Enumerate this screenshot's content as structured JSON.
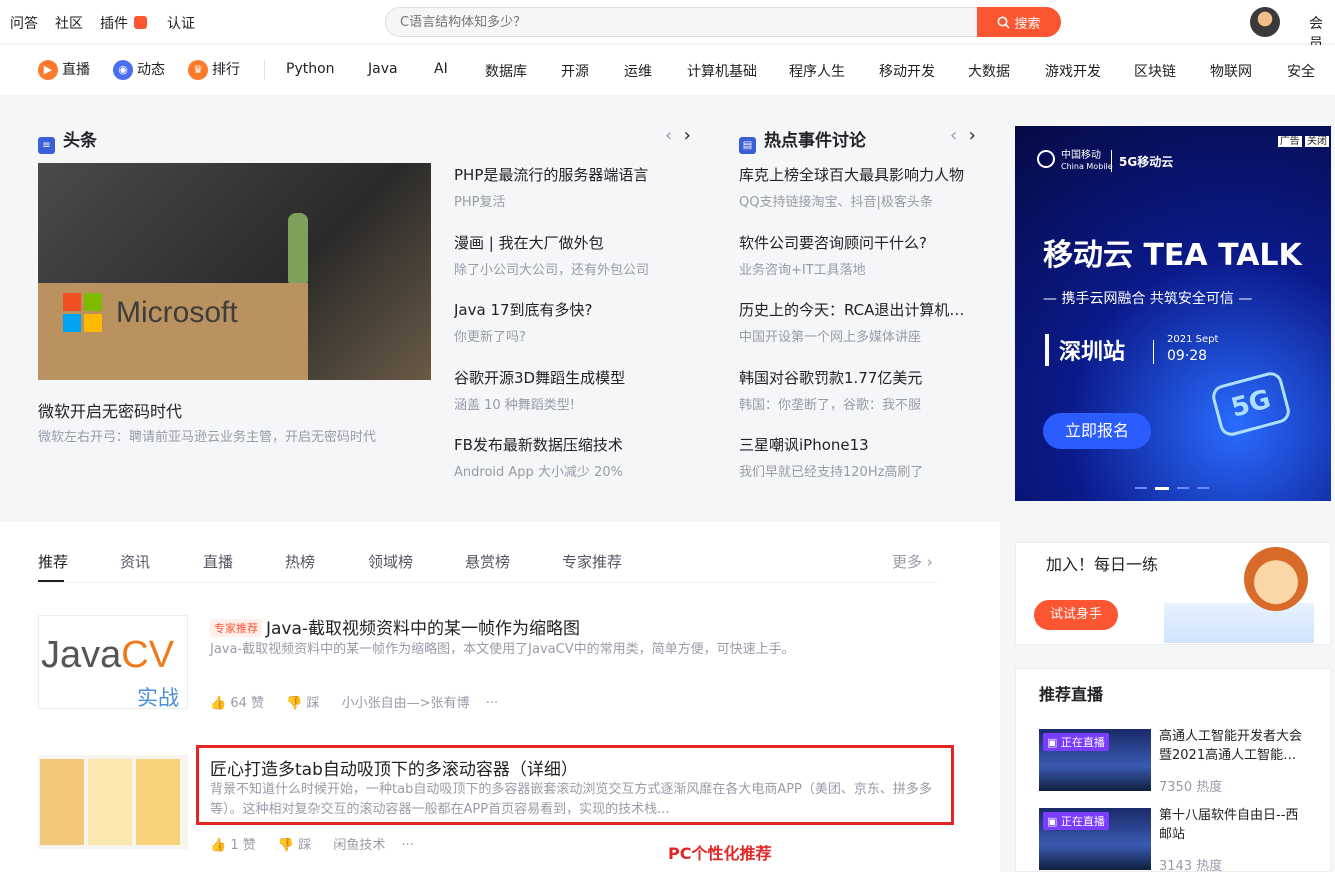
{
  "top": {
    "links": [
      "问答",
      "社区",
      "插件",
      "认证"
    ],
    "search_placeholder": "C语言结构体知多少？",
    "search_button": "搜索",
    "vip": "会员"
  },
  "nav": {
    "icon_items": [
      "直播",
      "动态",
      "排行"
    ],
    "items": [
      "Python",
      "Java",
      "AI",
      "数据库",
      "开源",
      "运维",
      "计算机基础",
      "程序人生",
      "移动开发",
      "大数据",
      "游戏开发",
      "区块链",
      "物联网",
      "安全"
    ]
  },
  "headline": {
    "title": "头条",
    "hero_text": "Microsoft",
    "hero_title": "微软开启无密码时代",
    "hero_sub": "微软左右开弓：聘请前亚马逊云业务主管，开启无密码时代",
    "news": [
      {
        "title": "PHP是最流行的服务器端语言",
        "sub": "PHP复活"
      },
      {
        "title": "漫画 | 我在大厂做外包",
        "sub": "除了小公司大公司，还有外包公司"
      },
      {
        "title": "Java 17到底有多快?",
        "sub": "你更新了吗?"
      },
      {
        "title": "谷歌开源3D舞蹈生成模型",
        "sub": "涵盖 10 种舞蹈类型!"
      },
      {
        "title": "FB发布最新数据压缩技术",
        "sub": "Android App 大小减少 20%"
      }
    ]
  },
  "hot": {
    "title": "热点事件讨论",
    "news": [
      {
        "title": "库克上榜全球百大最具影响力人物",
        "sub": "QQ支持链接淘宝、抖音|极客头条"
      },
      {
        "title": "软件公司要咨询顾问干什么?",
        "sub": "业务咨询+IT工具落地"
      },
      {
        "title": "历史上的今天：RCA退出计算机…",
        "sub": "中国开设第一个网上多媒体讲座"
      },
      {
        "title": "韩国对谷歌罚款1.77亿美元",
        "sub": "韩国：你垄断了，谷歌：我不服"
      },
      {
        "title": "三星嘲讽iPhone13",
        "sub": "我们早就已经支持120Hz高刷了"
      }
    ]
  },
  "ad": {
    "tags": [
      "广告",
      "关闭"
    ],
    "brand": "中国移动",
    "brand_en": "China Mobile",
    "brand2": "5G移动云",
    "headline": "移动云 TEA TALK",
    "tagline": "— 携手云网融合 共筑安全可信 —",
    "city": "深圳站",
    "date_line1": "2021 Sept",
    "date_line2": "09·28",
    "badge": "5G",
    "cta": "立即报名"
  },
  "feed": {
    "tabs": [
      "推荐",
      "资讯",
      "直播",
      "热榜",
      "领域榜",
      "悬赏榜",
      "专家推荐"
    ],
    "more": "更多",
    "articles": [
      {
        "tag": "专家推荐",
        "title": "Java-截取视频资料中的某一帧作为缩略图",
        "desc": "Java-截取视频资料中的某一帧作为缩略图，本文使用了JavaCV中的常用类，简单方便，可快速上手。",
        "likes": "64 赞",
        "dislike": "踩",
        "author": "小小张自由—>张有博",
        "more": "···",
        "thumb_main_a": "Java",
        "thumb_main_b": "CV",
        "thumb_sub": "实战"
      },
      {
        "title": "匠心打造多tab自动吸顶下的多滚动容器（详细）",
        "desc": "背景不知道什么时候开始，一种tab自动吸顶下的多容器嵌套滚动浏览交互方式逐渐风靡在各大电商APP（美团、京东、拼多多等）。这种相对复杂交互的滚动容器一般都在APP首页容易看到，实现的技术栈...",
        "likes": "1 赞",
        "dislike": "踩",
        "author": "闲鱼技术",
        "more": "···"
      }
    ],
    "annotation": "PC个性化推荐"
  },
  "sidebar": {
    "practice_title": "加入！每日一练",
    "practice_button": "试试身手",
    "live_title": "推荐直播",
    "live_badge": "正在直播",
    "lives": [
      {
        "title": "高通人工智能开发者大会暨2021高通人工智能…",
        "heat": "7350 热度"
      },
      {
        "title": "第十八届软件自由日--西邮站",
        "heat": "3143 热度"
      }
    ]
  }
}
